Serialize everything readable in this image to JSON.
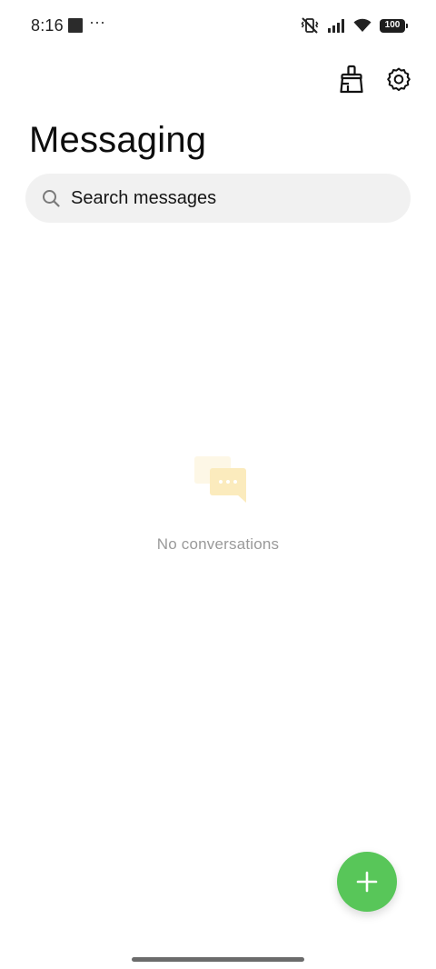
{
  "status_bar": {
    "time": "8:16",
    "overflow": "···",
    "battery": "100",
    "icons": [
      "vibrate-off-icon",
      "signal-icon",
      "wifi-icon",
      "battery-icon"
    ]
  },
  "toolbar": {
    "icons": [
      "broom-icon",
      "gear-icon"
    ]
  },
  "header": {
    "title": "Messaging"
  },
  "search": {
    "placeholder": "Search messages",
    "icon": "search-icon"
  },
  "empty_state": {
    "icon": "chat-bubbles-icon",
    "text": "No conversations"
  },
  "fab": {
    "icon": "plus-icon",
    "color": "#58c659"
  },
  "colors": {
    "background": "#ffffff",
    "search_bg": "#f1f1f1",
    "empty_text": "#9a9a9a",
    "accent": "#58c659"
  }
}
